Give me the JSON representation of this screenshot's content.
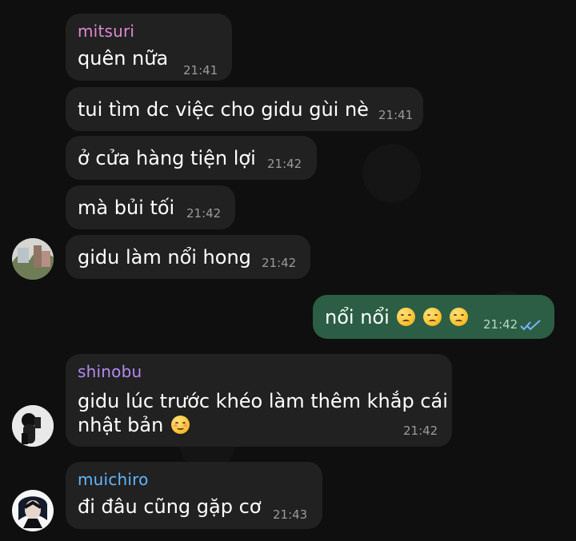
{
  "messages": [
    {
      "sender": "mitsuri",
      "text": "quên nữa",
      "time": "21:41"
    },
    {
      "text": "tui tìm dc việc cho gidu gùi nè",
      "time": "21:41"
    },
    {
      "text": "ở cửa hàng tiện lợi",
      "time": "21:42"
    },
    {
      "text": "mà bủi tối",
      "time": "21:42"
    },
    {
      "text": "gidu làm nổi hong",
      "time": "21:42"
    },
    {
      "text": "nổi nổi",
      "time": "21:42",
      "emoji": "pensive-face-icon"
    },
    {
      "sender": "shinobu",
      "line1": "gidu lúc trước khéo làm thêm khắp cái",
      "line2": "nhật bản",
      "time": "21:42",
      "emoji": "smiling-face-icon"
    },
    {
      "sender": "muichiro",
      "text": "đi đâu cũng gặp cơ",
      "time": "21:43"
    }
  ],
  "colors": {
    "background": "#0f0f0f",
    "incoming_bubble": "#212121",
    "outgoing_bubble": "#2b5e44",
    "mitsuri": "#de8ad1",
    "shinobu": "#b48af1",
    "muichiro": "#62b6ff",
    "read_receipt": "#7fb1ff"
  }
}
